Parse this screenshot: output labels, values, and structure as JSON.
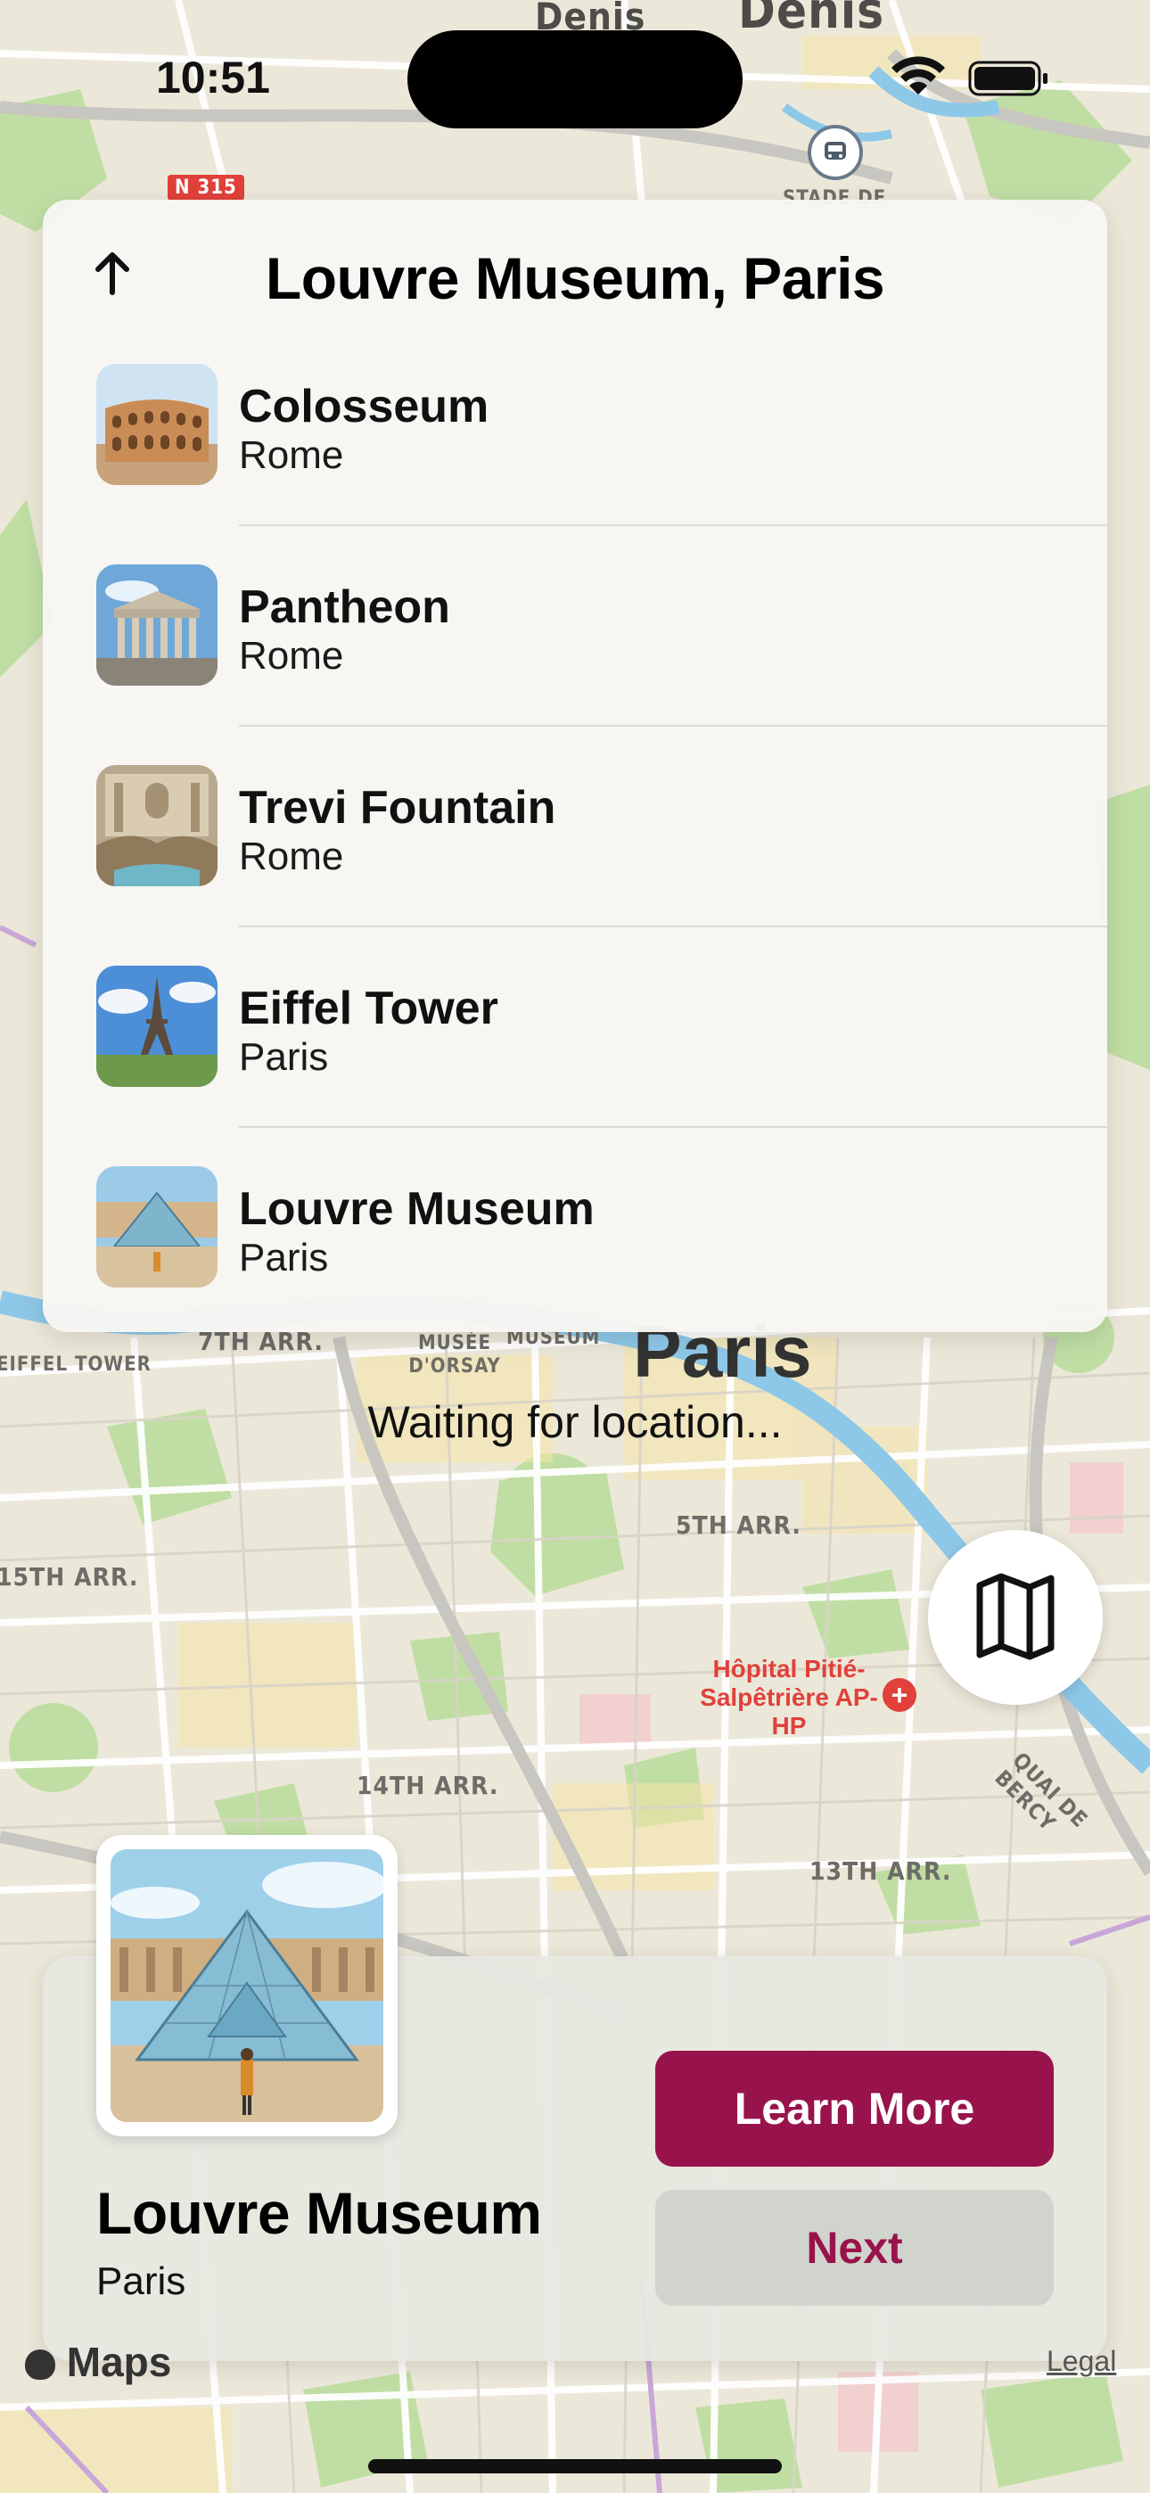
{
  "status_bar": {
    "time": "10:51"
  },
  "map": {
    "labels": [
      "Denis",
      "Denis",
      "N 315",
      "STADE DE",
      "7TH ARR.",
      "MUSÉE D'ORSAY",
      "MUSEUM",
      "Paris",
      "EIFFEL TOWER",
      "5TH ARR.",
      "15TH ARR.",
      "Hôpital Pitié-Salpêtrière AP-HP",
      "14TH ARR.",
      "13TH ARR.",
      "QUAI DE BERCY"
    ]
  },
  "panel": {
    "title": "Louvre Museum, Paris",
    "items": [
      {
        "name": "Colosseum",
        "city": "Rome"
      },
      {
        "name": "Pantheon",
        "city": "Rome"
      },
      {
        "name": "Trevi Fountain",
        "city": "Rome"
      },
      {
        "name": "Eiffel Tower",
        "city": "Paris"
      },
      {
        "name": "Louvre Museum",
        "city": "Paris"
      }
    ]
  },
  "status_text": "Waiting for location...",
  "card": {
    "title": "Louvre Museum",
    "city": "Paris",
    "learn_more_label": "Learn More",
    "next_label": "Next"
  },
  "attribution": {
    "maps_label": "Maps",
    "legal_label": "Legal"
  },
  "colors": {
    "accent": "#98134b",
    "map_base": "#ece8d9",
    "river": "#8ec8e8",
    "park": "#b9dc9a"
  }
}
